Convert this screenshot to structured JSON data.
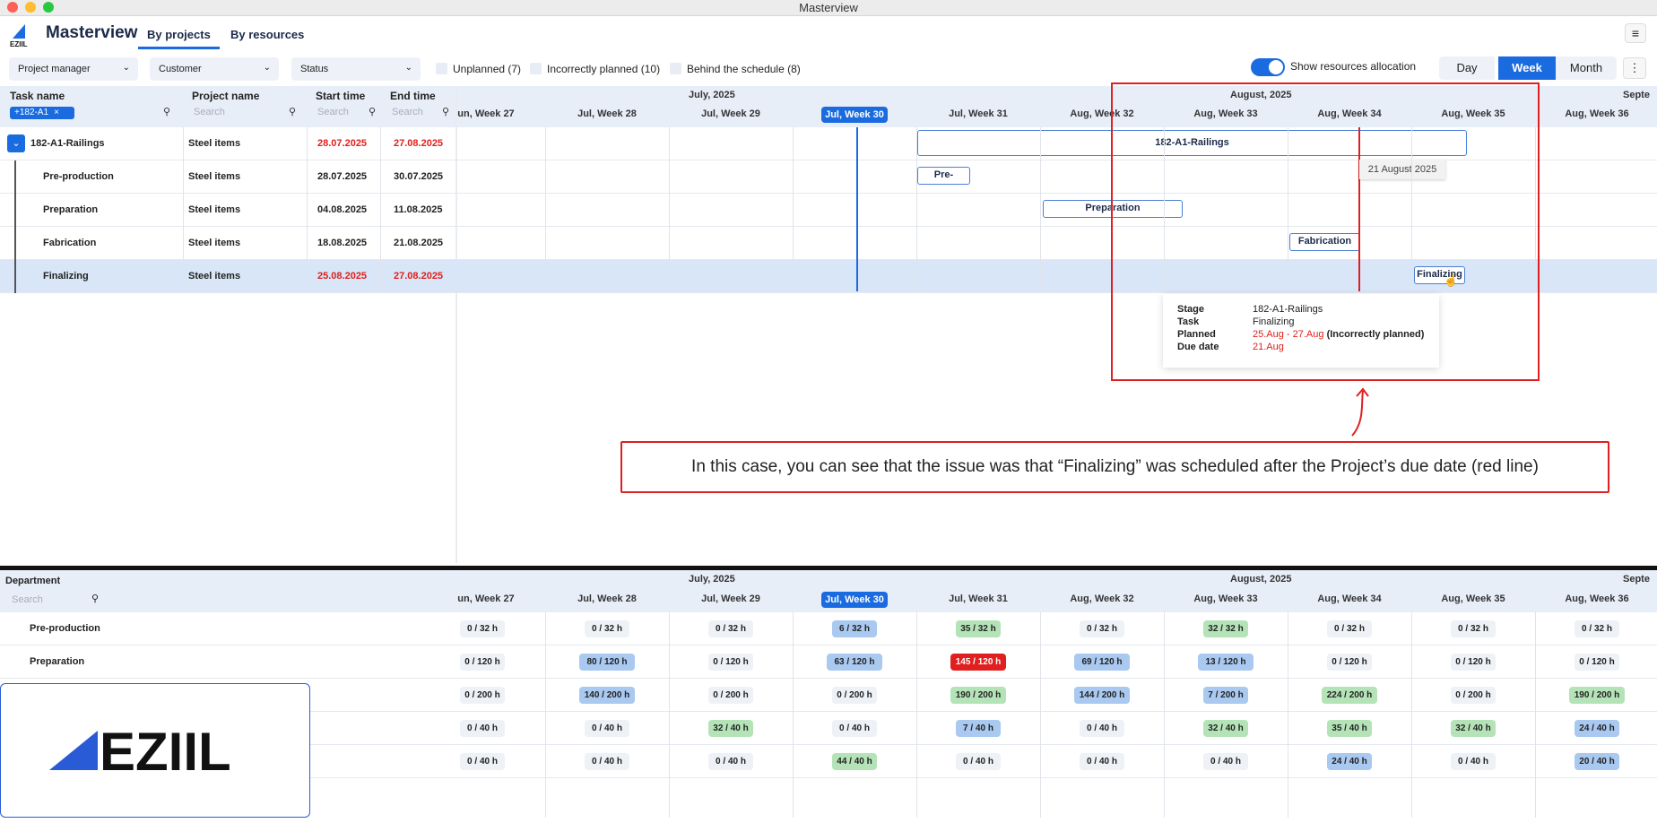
{
  "window": {
    "title": "Masterview"
  },
  "app": {
    "title": "Masterview",
    "tabs": [
      "By projects",
      "By resources"
    ]
  },
  "filters": {
    "dropdowns": [
      "Project manager",
      "Customer",
      "Status"
    ],
    "checkboxes": [
      "Unplanned (7)",
      "Incorrectly planned (10)",
      "Behind the schedule (8)"
    ],
    "toggle_label": "Show resources allocation",
    "views": [
      "Day",
      "Week",
      "Month"
    ],
    "active_view": "Week"
  },
  "grid": {
    "columns": [
      "Task name",
      "Project name",
      "Start time",
      "End time"
    ],
    "search_placeholder": "Search",
    "chip": "+182-A1",
    "months": [
      "July, 2025",
      "August, 2025",
      "Septe"
    ],
    "weeks": [
      "un, Week 27",
      "Jul, Week 28",
      "Jul, Week 29",
      "Jul, Week 30",
      "Jul, Week 31",
      "Aug, Week 32",
      "Aug, Week 33",
      "Aug, Week 34",
      "Aug, Week 35",
      "Aug, Week 36"
    ],
    "current_week": "Jul, Week 30",
    "rows": [
      {
        "task": "182-A1-Railings",
        "project": "Steel items",
        "start": "28.07.2025",
        "end": "27.08.2025",
        "red": true
      },
      {
        "task": "Pre-production",
        "project": "Steel items",
        "start": "28.07.2025",
        "end": "30.07.2025",
        "red": false
      },
      {
        "task": "Preparation",
        "project": "Steel items",
        "start": "04.08.2025",
        "end": "11.08.2025",
        "red": false
      },
      {
        "task": "Fabrication",
        "project": "Steel items",
        "start": "18.08.2025",
        "end": "21.08.2025",
        "red": false
      },
      {
        "task": "Finalizing",
        "project": "Steel items",
        "start": "25.08.2025",
        "end": "27.08.2025",
        "red": true
      }
    ],
    "bars": [
      "182-A1-Railings",
      "Pre-produc",
      "Preparation",
      "Fabrication",
      "Finalizing"
    ],
    "due_date_tip": "21 August 2025"
  },
  "tooltip": {
    "labels": [
      "Stage",
      "Task",
      "Planned",
      "Due date"
    ],
    "stage": "182-A1-Railings",
    "task": "Finalizing",
    "planned": "25.Aug - 27.Aug",
    "planned_note": "(Incorrectly planned)",
    "due": "21.Aug"
  },
  "callout": "In this case, you can see that the issue was that “Finalizing” was scheduled after the Project’s due date (red line)",
  "resources": {
    "header": "Department",
    "search_placeholder": "Search",
    "rows": [
      {
        "name": "Pre-production",
        "cells": [
          [
            "0 / 32 h",
            "gray"
          ],
          [
            "0 / 32 h",
            "gray"
          ],
          [
            "0 / 32 h",
            "gray"
          ],
          [
            "6 / 32 h",
            "blue"
          ],
          [
            "35 / 32 h",
            "green"
          ],
          [
            "0 / 32 h",
            "gray"
          ],
          [
            "32 / 32 h",
            "green"
          ],
          [
            "0 / 32 h",
            "gray"
          ],
          [
            "0 / 32 h",
            "gray"
          ],
          [
            "0 / 32 h",
            "gray"
          ]
        ]
      },
      {
        "name": "Preparation",
        "cells": [
          [
            "0 / 120 h",
            "gray"
          ],
          [
            "80 / 120 h",
            "blue"
          ],
          [
            "0 / 120 h",
            "gray"
          ],
          [
            "63 / 120 h",
            "blue"
          ],
          [
            "145 / 120 h",
            "red"
          ],
          [
            "69 / 120 h",
            "blue"
          ],
          [
            "13 / 120 h",
            "blue"
          ],
          [
            "0 / 120 h",
            "gray"
          ],
          [
            "0 / 120 h",
            "gray"
          ],
          [
            "0 / 120 h",
            "gray"
          ]
        ]
      },
      {
        "name": "",
        "cells": [
          [
            "0 / 200 h",
            "gray"
          ],
          [
            "140 / 200 h",
            "blue"
          ],
          [
            "0 / 200 h",
            "gray"
          ],
          [
            "0 / 200 h",
            "gray"
          ],
          [
            "190 / 200 h",
            "green"
          ],
          [
            "144 / 200 h",
            "blue"
          ],
          [
            "7 / 200 h",
            "blue"
          ],
          [
            "224 / 200 h",
            "green"
          ],
          [
            "0 / 200 h",
            "gray"
          ],
          [
            "190 / 200 h",
            "green"
          ]
        ]
      },
      {
        "name": "",
        "cells": [
          [
            "0 / 40 h",
            "gray"
          ],
          [
            "0 / 40 h",
            "gray"
          ],
          [
            "32 / 40 h",
            "green"
          ],
          [
            "0 / 40 h",
            "gray"
          ],
          [
            "7 / 40 h",
            "blue"
          ],
          [
            "0 / 40 h",
            "gray"
          ],
          [
            "32 / 40 h",
            "green"
          ],
          [
            "35 / 40 h",
            "green"
          ],
          [
            "32 / 40 h",
            "green"
          ],
          [
            "24 / 40 h",
            "blue"
          ]
        ]
      },
      {
        "name": "",
        "cells": [
          [
            "0 / 40 h",
            "gray"
          ],
          [
            "0 / 40 h",
            "gray"
          ],
          [
            "0 / 40 h",
            "gray"
          ],
          [
            "44 / 40 h",
            "green"
          ],
          [
            "0 / 40 h",
            "gray"
          ],
          [
            "0 / 40 h",
            "gray"
          ],
          [
            "0 / 40 h",
            "gray"
          ],
          [
            "24 / 40 h",
            "blue"
          ],
          [
            "0 / 40 h",
            "gray"
          ],
          [
            "20 / 40 h",
            "blue"
          ]
        ]
      }
    ]
  },
  "brand": {
    "logo_text": "EZIIL",
    "logo_small": "EZIIL"
  }
}
